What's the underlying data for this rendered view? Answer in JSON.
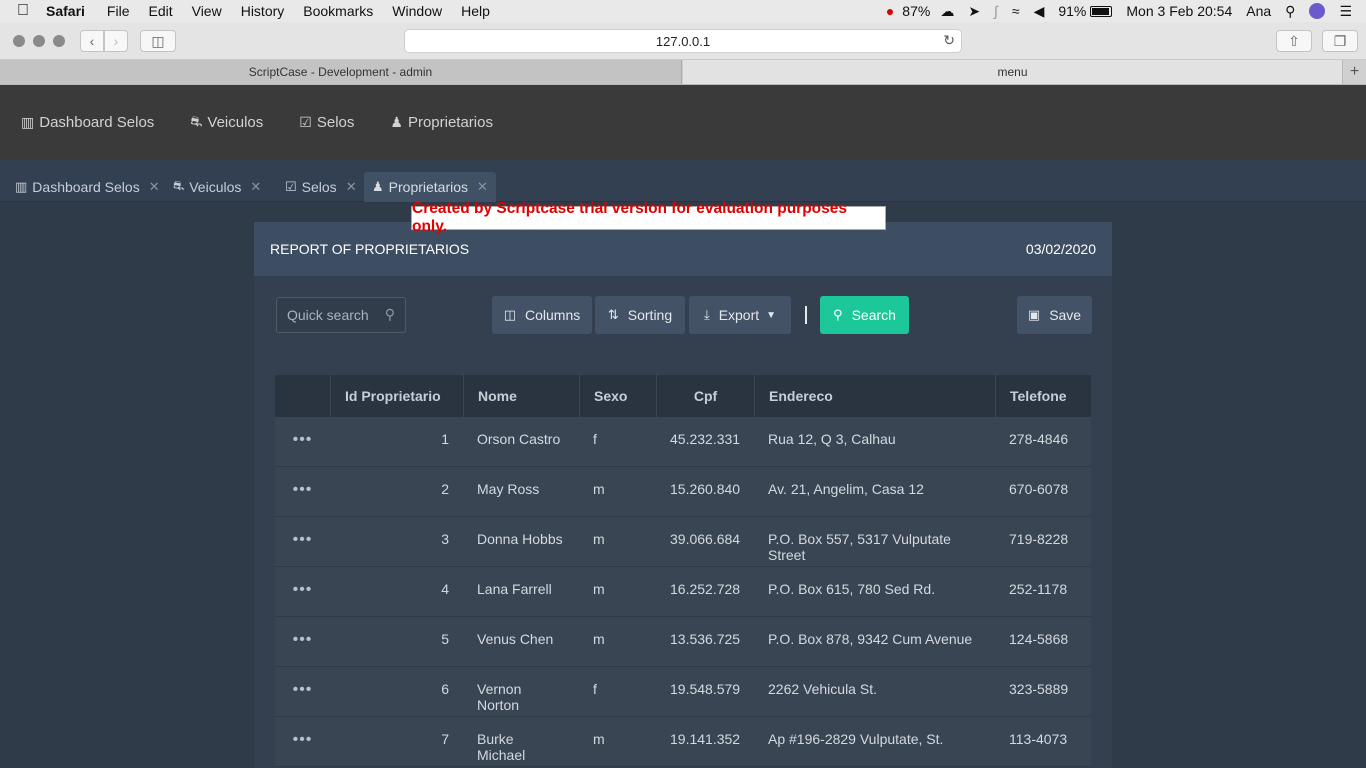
{
  "mac_menu": {
    "apple": "",
    "app": "Safari",
    "items": [
      "File",
      "Edit",
      "View",
      "History",
      "Bookmarks",
      "Window",
      "Help"
    ],
    "status": {
      "battery_small": "87%",
      "battery": "91%",
      "datetime": "Mon 3 Feb  20:54",
      "user": "Ana"
    }
  },
  "browser": {
    "address": "127.0.0.1",
    "tabs": [
      "ScriptCase - Development - admin",
      "menu"
    ]
  },
  "app_nav": {
    "items": [
      {
        "label": "Dashboard Selos",
        "icon": "bar-chart-icon"
      },
      {
        "label": "Veiculos",
        "icon": "car-icon"
      },
      {
        "label": "Selos",
        "icon": "checkbox-icon"
      },
      {
        "label": "Proprietarios",
        "icon": "user-icon"
      }
    ]
  },
  "sc_tabs": [
    {
      "label": "Dashboard Selos"
    },
    {
      "label": "Veiculos"
    },
    {
      "label": "Selos"
    },
    {
      "label": "Proprietarios"
    }
  ],
  "trial_notice": "Created by Scriptcase trial version for evaluation purposes only.",
  "report": {
    "title": "REPORT OF PROPRIETARIOS",
    "date": "03/02/2020",
    "quick_search_placeholder": "Quick search",
    "buttons": {
      "columns": "Columns",
      "sorting": "Sorting",
      "export": "Export",
      "search": "Search",
      "save": "Save"
    },
    "columns": [
      "Id Proprietario",
      "Nome",
      "Sexo",
      "Cpf",
      "Endereco",
      "Telefone"
    ],
    "rows": [
      {
        "id": "1",
        "nome": "Orson Castro",
        "sexo": "f",
        "cpf": "45.232.331",
        "endereco": "Rua 12, Q 3, Calhau",
        "telefone": "278-4846"
      },
      {
        "id": "2",
        "nome": "May Ross",
        "sexo": "m",
        "cpf": "15.260.840",
        "endereco": "Av. 21, Angelim, Casa 12",
        "telefone": "670-6078"
      },
      {
        "id": "3",
        "nome": "Donna Hobbs",
        "sexo": "m",
        "cpf": "39.066.684",
        "endereco": "P.O. Box 557, 5317 Vulputate Street",
        "telefone": "719-8228"
      },
      {
        "id": "4",
        "nome": "Lana Farrell",
        "sexo": "m",
        "cpf": "16.252.728",
        "endereco": "P.O. Box 615, 780 Sed Rd.",
        "telefone": "252-1178"
      },
      {
        "id": "5",
        "nome": "Venus Chen",
        "sexo": "m",
        "cpf": "13.536.725",
        "endereco": "P.O. Box 878, 9342 Cum Avenue",
        "telefone": "124-5868"
      },
      {
        "id": "6",
        "nome": "Vernon Norton",
        "sexo": "f",
        "cpf": "19.548.579",
        "endereco": "2262 Vehicula St.",
        "telefone": "323-5889"
      },
      {
        "id": "7",
        "nome": "Burke Michael",
        "sexo": "m",
        "cpf": "19.141.352",
        "endereco": "Ap #196-2829 Vulputate, St.",
        "telefone": "113-4073"
      }
    ]
  }
}
